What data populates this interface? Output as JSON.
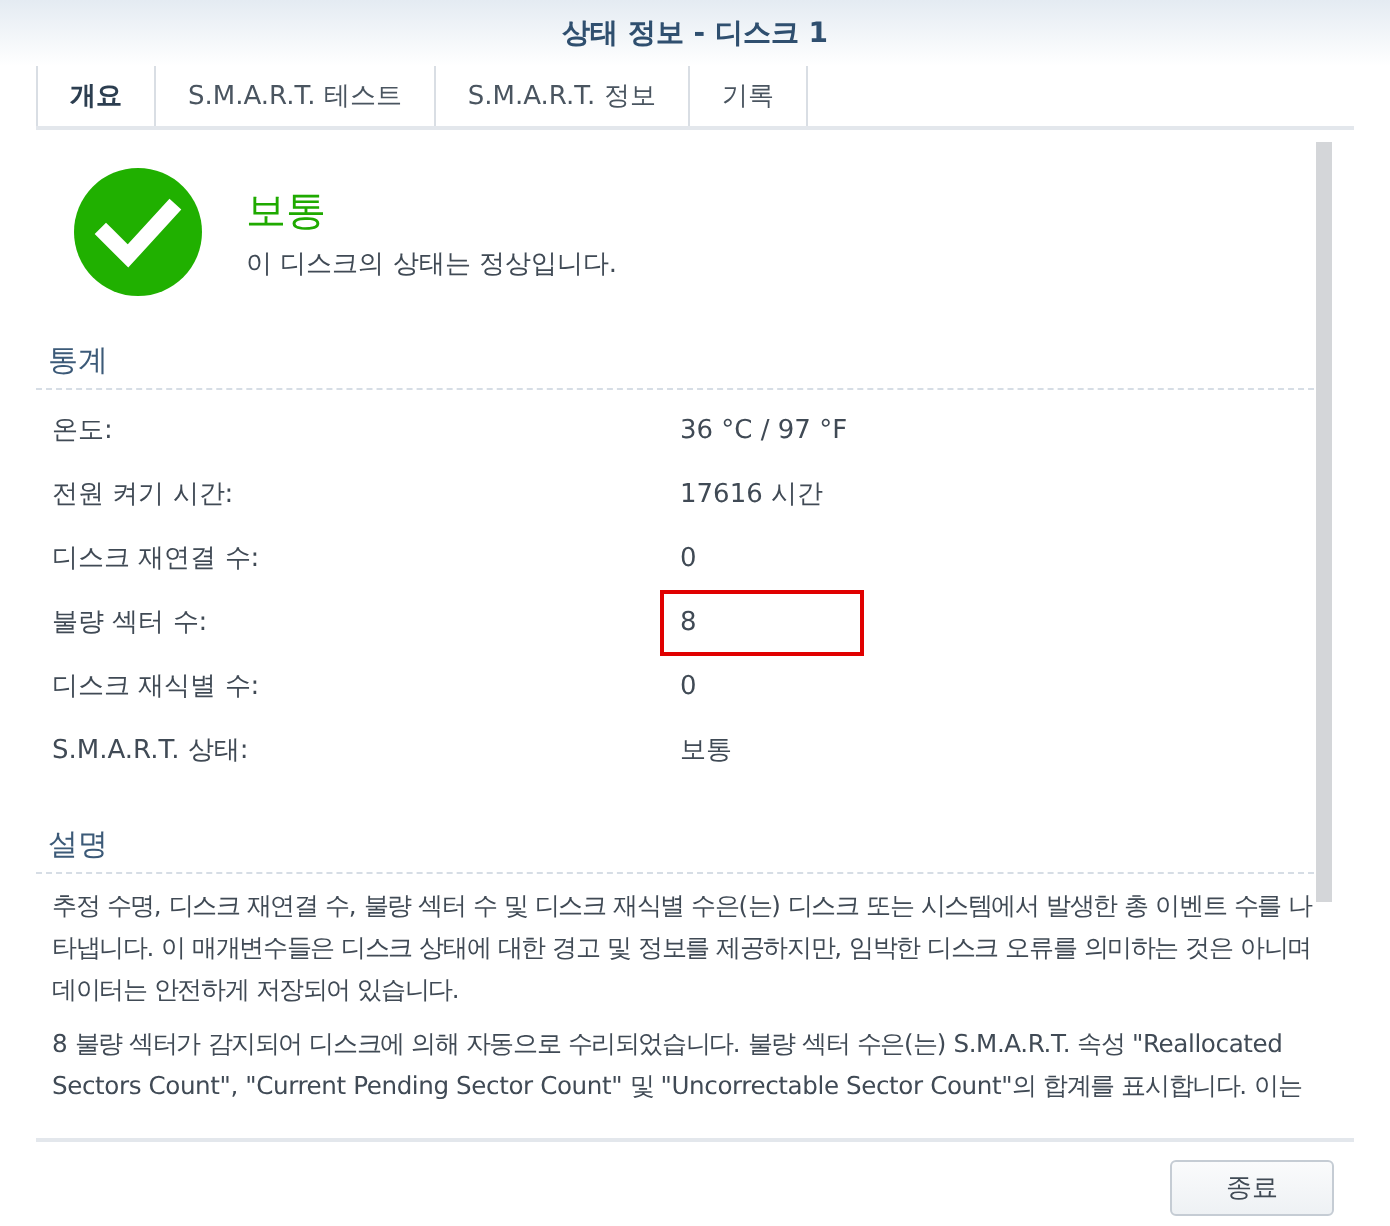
{
  "window": {
    "title": "상태 정보 - 디스크 1"
  },
  "tabs": [
    {
      "label": "개요",
      "selected": true
    },
    {
      "label": "S.M.A.R.T. 테스트",
      "selected": false
    },
    {
      "label": "S.M.A.R.T. 정보",
      "selected": false
    },
    {
      "label": "기록",
      "selected": false
    }
  ],
  "status": {
    "title": "보통",
    "message": "이 디스크의 상태는 정상입니다."
  },
  "statistics": {
    "heading": "통계",
    "rows": [
      {
        "label": "온도:",
        "value": "36 °C / 97 °F",
        "highlighted": false
      },
      {
        "label": "전원 켜기 시간:",
        "value": "17616 시간",
        "highlighted": false
      },
      {
        "label": "디스크 재연결 수:",
        "value": "0",
        "highlighted": false
      },
      {
        "label": "불량 섹터 수:",
        "value": "8",
        "highlighted": true
      },
      {
        "label": "디스크 재식별 수:",
        "value": "0",
        "highlighted": false
      },
      {
        "label": "S.M.A.R.T. 상태:",
        "value": "보통",
        "highlighted": false
      }
    ]
  },
  "description": {
    "heading": "설명",
    "paragraphs": [
      "추정 수명, 디스크 재연결 수, 불량 섹터 수 및 디스크 재식별 수은(는) 디스크 또는 시스템에서 발생한 총 이벤트 수를 나타냅니다. 이 매개변수들은 디스크 상태에 대한 경고 및 정보를 제공하지만, 임박한 디스크 오류를 의미하는 것은 아니며 데이터는 안전하게 저장되어 있습니다.",
      "8 불량 섹터가 감지되어 디스크에 의해 자동으로 수리되었습니다. 불량 섹터 수은(는) S.M.A.R.T. 속성 \"Reallocated Sectors Count\", \"Current Pending Sector Count\" 및 \"Uncorrectable Sector Count\"의 합계를 표시합니다. 이는"
    ]
  },
  "buttons": [
    "종료"
  ]
}
